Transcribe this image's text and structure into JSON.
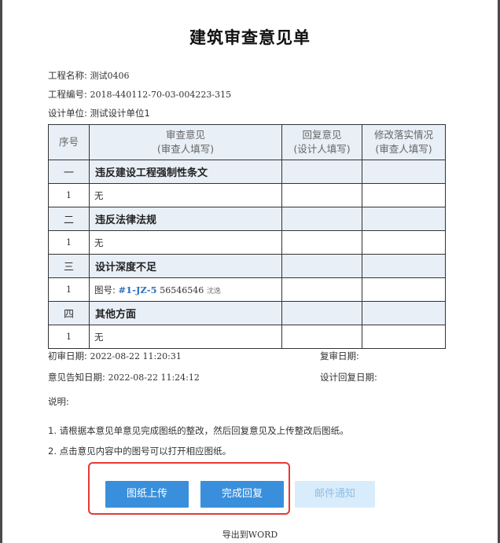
{
  "title": "建筑审查意见单",
  "project": {
    "name_label": "工程名称:",
    "name_value": "测试0406",
    "code_label": "工程编号:",
    "code_value": "2018-440112-70-03-004223-315",
    "unit_label": "设计单位:",
    "unit_value": "测试设计单位1"
  },
  "table": {
    "headers": {
      "seq": "序号",
      "opinion_line1": "审查意见",
      "opinion_line2": "(审查人填写)",
      "reply_line1": "回复意见",
      "reply_line2": "(设计人填写)",
      "fix_line1": "修改落实情况",
      "fix_line2": "(审查人填写)"
    },
    "sections": [
      {
        "num": "一",
        "name": "违反建设工程强制性条文",
        "item_num": "1",
        "item_text": "无"
      },
      {
        "num": "二",
        "name": "违反法律法规",
        "item_num": "1",
        "item_text": "无"
      },
      {
        "num": "三",
        "name": "设计深度不足",
        "item_num": "1",
        "item_prefix": "图号:",
        "item_link": "#1-JZ-5",
        "item_value": "56546546",
        "item_note": "沈逸"
      },
      {
        "num": "四",
        "name": "其他方面",
        "item_num": "1",
        "item_text": "无"
      }
    ]
  },
  "dates": {
    "first_review_label": "初审日期:",
    "first_review_value": "2022-08-22 11:20:31",
    "re_review_label": "复审日期:",
    "notice_label": "意见告知日期:",
    "notice_value": "2022-08-22 11:24:12",
    "design_reply_label": "设计回复日期:"
  },
  "notes": {
    "heading": "说明:",
    "line1": "1. 请根据本意见单意见完成图纸的整改，然后回复意见及上传整改后图纸。",
    "line2": "2. 点击意见内容中的图号可以打开相应图纸。"
  },
  "buttons": {
    "upload": "图纸上传",
    "complete": "完成回复",
    "email": "邮件通知"
  },
  "export": {
    "prefix": "导出到",
    "word": "WORD"
  },
  "colors": {
    "primary_button": "#3a8fdc",
    "disabled_button": "#d9ecfb",
    "highlight_box": "#e53935",
    "link": "#2f6fbd",
    "header_bg": "#e8eff7"
  }
}
